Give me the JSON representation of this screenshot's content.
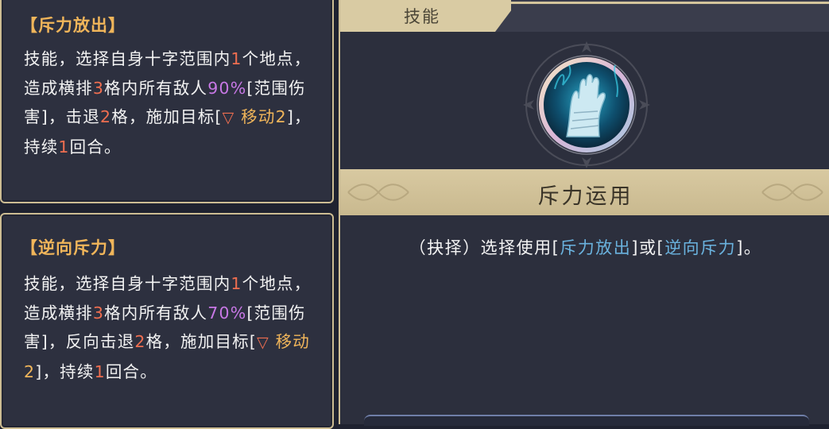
{
  "tooltips": [
    {
      "title": "【斥力放出】",
      "body": [
        {
          "t": "技能，选择自身十字范围内"
        },
        {
          "n": "1"
        },
        {
          "t": "个地点，造成横排"
        },
        {
          "n": "3"
        },
        {
          "t": "格内所有敌人"
        },
        {
          "p": "90%"
        },
        {
          "t": "[范围伤害]，击退"
        },
        {
          "n": "2"
        },
        {
          "t": "格，施加目标["
        },
        {
          "tri": "▽"
        },
        {
          "e": " 移动2"
        },
        {
          "t": "]，持续"
        },
        {
          "n": "1"
        },
        {
          "t": "回合。"
        }
      ]
    },
    {
      "title": "【逆向斥力】",
      "body": [
        {
          "t": "技能，选择自身十字范围内"
        },
        {
          "n": "1"
        },
        {
          "t": "个地点，造成横排"
        },
        {
          "n": "3"
        },
        {
          "t": "格内所有敌人"
        },
        {
          "p": "70%"
        },
        {
          "t": "[范围伤害]，反向击退"
        },
        {
          "n": "2"
        },
        {
          "t": "格，施加目标["
        },
        {
          "tri": "▽"
        },
        {
          "e": " 移动2"
        },
        {
          "t": "]，持续"
        },
        {
          "n": "1"
        },
        {
          "t": "回合。"
        }
      ]
    }
  ],
  "panel": {
    "tab_label": "技能",
    "skill_icon": "blue-flame-hand-icon",
    "skill_name": "斥力运用",
    "description": {
      "prefix": "（抉择）选择使用[",
      "link1": "斥力放出",
      "middle": "]或[",
      "link2": "逆向斥力",
      "suffix": "]。"
    }
  },
  "colors": {
    "highlight_number": "#ef6e50",
    "percent": "#c878e6",
    "effect": "#f0b55a",
    "link": "#6ab2de",
    "gold": "#d8c9a1"
  }
}
